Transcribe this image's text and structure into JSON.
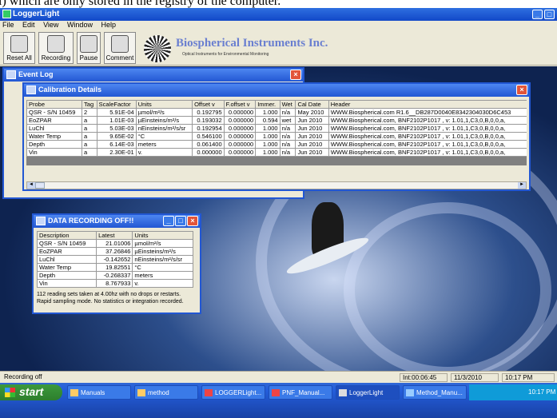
{
  "clipped_caption": "l) which are only stored in the registry of the computer.",
  "app": {
    "title": "LoggerLight"
  },
  "menu": [
    "File",
    "Edit",
    "View",
    "Window",
    "Help"
  ],
  "toolbar": {
    "reset": "Reset All",
    "recording": "Recording",
    "pause": "Pause",
    "comment": "Comment"
  },
  "brand": {
    "name": "Biospherical Instruments Inc.",
    "tagline": "Optical Instruments for Environmental Monitoring"
  },
  "event_log": {
    "title": "Event Log"
  },
  "calibration": {
    "title": "Calibration Details",
    "headers": [
      "Probe",
      "Tag",
      "ScaleFactor",
      "Units",
      "Offset v",
      "F.offset v",
      "Immer.",
      "Wet",
      "Cal Date",
      "Header"
    ],
    "rows": [
      [
        "QSR - S/N 10459",
        "2",
        "5.91E-04",
        "µmol/m²/s",
        "0.192795",
        "0.000000",
        "1.000",
        "n/a",
        "May 2010",
        "WWW.Biospherical.com R1.6__DB287D0040E8342304030D6C453"
      ],
      [
        "EoZPAR",
        "a",
        "1.01E-03",
        "µEinsteins/m²/s",
        "0.193032",
        "0.000000",
        "0.594",
        "wet",
        "Jun 2010",
        "WWW.Biospherical.com, BNF2102P1017   , v: 1.01,1,C3,0,B,0,0,a,"
      ],
      [
        "LuChl",
        "a",
        "5.03E-03",
        "nEinsteins/m²/s/sr",
        "0.192954",
        "0.000000",
        "1.000",
        "n/a",
        "Jun 2010",
        "WWW.Biospherical.com, BNF2102P1017   , v: 1.01,1,C3,0,B,0,0,a,"
      ],
      [
        "Water Temp",
        "a",
        "9.65E-02",
        "°C",
        "0.546100",
        "0.000000",
        "1.000",
        "n/a",
        "Jun 2010",
        "WWW.Biospherical.com, BNF2102P1017   , v: 1.01,1,C3,0,B,0,0,a,"
      ],
      [
        "Depth",
        "a",
        "6.14E-03",
        "meters",
        "0.061400",
        "0.000000",
        "1.000",
        "n/a",
        "Jun 2010",
        "WWW.Biospherical.com, BNF2102P1017   , v: 1.01,1,C3,0,B,0,0,a,"
      ],
      [
        "Vin",
        "a",
        "2.30E-01",
        "v.",
        "0.000000",
        "0.000000",
        "1.000",
        "n/a",
        "Jun 2010",
        "WWW.Biospherical.com, BNF2102P1017   , v: 1.01,1,C3,0,B,0,0,a,"
      ]
    ]
  },
  "recording": {
    "title": "DATA RECORDING OFF!!",
    "headers": [
      "Description",
      "Latest",
      "Units"
    ],
    "rows": [
      [
        "QSR - S/N 10459",
        "21.01006",
        "µmol/m²/s"
      ],
      [
        "EoZPAR",
        "37.26846",
        "µEinsteins/m²/s"
      ],
      [
        "LuChl",
        "-0.142652",
        "nEinsteins/m²/s/sr"
      ],
      [
        "Water Temp",
        "19.82551",
        "°C"
      ],
      [
        "Depth",
        "-0.268337",
        "meters"
      ],
      [
        "Vin",
        "8.767933",
        "v."
      ]
    ],
    "note1": "112 reading sets taken at 4.00hz with no drops or restarts.",
    "note2": "Rapid sampling mode.  No statistics or integration recorded."
  },
  "status": {
    "left": "Recording off",
    "interval": "Int:00:06:45",
    "date": "11/3/2010",
    "time": "10:17 PM"
  },
  "taskbar": {
    "start": "start",
    "tasks": [
      "Manuals",
      "method",
      "LOGGERLight...",
      "PNF_Manual...",
      "LoggerLight",
      "Method_Manu..."
    ],
    "clock": "10:17 PM"
  }
}
